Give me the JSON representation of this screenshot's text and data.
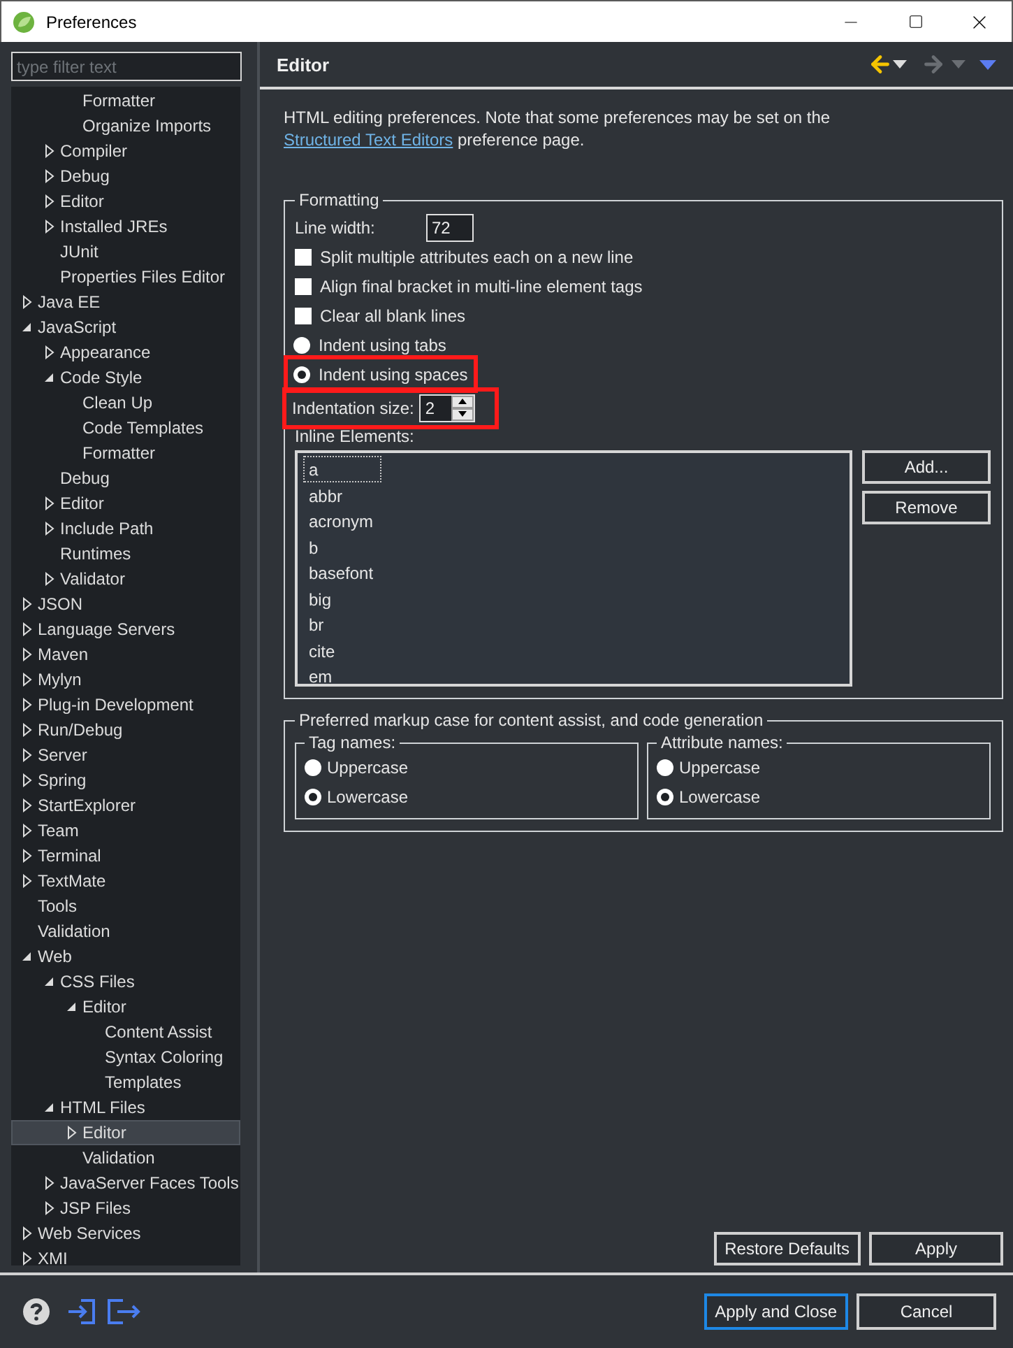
{
  "window": {
    "title": "Preferences"
  },
  "filter": {
    "placeholder": "type filter text"
  },
  "tree": [
    {
      "children": [
        {
          "children": [
            {
              "label": "Formatter",
              "selected": false
            },
            {
              "label": "Organize Imports",
              "selected": false
            }
          ]
        },
        {
          "label": "Compiler",
          "expanded": false,
          "selected": false
        },
        {
          "label": "Debug",
          "expanded": false,
          "selected": false
        },
        {
          "label": "Editor",
          "expanded": false,
          "selected": false
        },
        {
          "label": "Installed JREs",
          "expanded": false,
          "selected": false
        },
        {
          "label": "JUnit",
          "selected": false
        },
        {
          "label": "Properties Files Editor",
          "selected": false
        }
      ]
    },
    {
      "label": "Java EE",
      "expanded": false,
      "selected": false
    },
    {
      "label": "JavaScript",
      "expanded": true,
      "selected": false,
      "children": [
        {
          "label": "Appearance",
          "expanded": false,
          "selected": false
        },
        {
          "label": "Code Style",
          "expanded": true,
          "selected": false,
          "children": [
            {
              "label": "Clean Up",
              "selected": false
            },
            {
              "label": "Code Templates",
              "selected": false
            },
            {
              "label": "Formatter",
              "selected": false
            }
          ]
        },
        {
          "label": "Debug",
          "selected": false
        },
        {
          "label": "Editor",
          "expanded": false,
          "selected": false
        },
        {
          "label": "Include Path",
          "expanded": false,
          "selected": false
        },
        {
          "label": "Runtimes",
          "selected": false
        },
        {
          "label": "Validator",
          "expanded": false,
          "selected": false
        }
      ]
    },
    {
      "label": "JSON",
      "expanded": false,
      "selected": false
    },
    {
      "label": "Language Servers",
      "expanded": false,
      "selected": false
    },
    {
      "label": "Maven",
      "expanded": false,
      "selected": false
    },
    {
      "label": "Mylyn",
      "expanded": false,
      "selected": false
    },
    {
      "label": "Plug-in Development",
      "expanded": false,
      "selected": false
    },
    {
      "label": "Run/Debug",
      "expanded": false,
      "selected": false
    },
    {
      "label": "Server",
      "expanded": false,
      "selected": false
    },
    {
      "label": "Spring",
      "expanded": false,
      "selected": false
    },
    {
      "label": "StartExplorer",
      "expanded": false,
      "selected": false
    },
    {
      "label": "Team",
      "expanded": false,
      "selected": false
    },
    {
      "label": "Terminal",
      "expanded": false,
      "selected": false
    },
    {
      "label": "TextMate",
      "expanded": false,
      "selected": false
    },
    {
      "label": "Tools",
      "selected": false
    },
    {
      "label": "Validation",
      "selected": false
    },
    {
      "label": "Web",
      "expanded": true,
      "selected": false,
      "children": [
        {
          "label": "CSS Files",
          "expanded": true,
          "selected": false,
          "children": [
            {
              "label": "Editor",
              "expanded": true,
              "selected": false,
              "children": [
                {
                  "label": "Content Assist",
                  "selected": false
                },
                {
                  "label": "Syntax Coloring",
                  "selected": false
                },
                {
                  "label": "Templates",
                  "selected": false
                }
              ]
            }
          ]
        },
        {
          "label": "HTML Files",
          "expanded": true,
          "selected": false,
          "children": [
            {
              "label": "Editor",
              "expanded": false,
              "selected": true
            },
            {
              "label": "Validation",
              "selected": false
            }
          ]
        },
        {
          "label": "JavaServer Faces Tools",
          "expanded": false,
          "selected": false
        },
        {
          "label": "JSP Files",
          "expanded": false,
          "selected": false
        }
      ]
    },
    {
      "label": "Web Services",
      "expanded": false,
      "selected": false
    },
    {
      "label": "XMI",
      "expanded": false,
      "selected": false
    }
  ],
  "page": {
    "title": "Editor",
    "description": "HTML editing preferences.  Note that some preferences may be set on the ",
    "link": "Structured Text Editors",
    "description_end": " preference page."
  },
  "formatting": {
    "title": "Formatting",
    "line_width": {
      "label": "Line width:",
      "value": "72"
    },
    "options": [
      {
        "kind": "checkbox",
        "label": "Split multiple attributes each on a new line",
        "checked": false
      },
      {
        "kind": "checkbox",
        "label": "Align final bracket in multi-line element tags",
        "checked": false
      },
      {
        "kind": "checkbox",
        "label": "Clear all blank lines",
        "checked": false
      },
      {
        "kind": "radio",
        "label": "Indent using tabs",
        "selected": false,
        "highlighted": false
      },
      {
        "kind": "radio",
        "label": "Indent using spaces",
        "selected": true,
        "highlighted": true
      }
    ],
    "indentation": {
      "label": "Indentation size:",
      "value": "2",
      "highlighted": true
    },
    "inline_elements": {
      "label": "Inline Elements:",
      "items": [
        {
          "text": "a",
          "focused": true
        },
        {
          "text": "abbr",
          "focused": false
        },
        {
          "text": "acronym",
          "focused": false
        },
        {
          "text": "b",
          "focused": false
        },
        {
          "text": "basefont",
          "focused": false
        },
        {
          "text": "big",
          "focused": false
        },
        {
          "text": "br",
          "focused": false
        },
        {
          "text": "cite",
          "focused": false
        },
        {
          "text": "em",
          "focused": false
        }
      ],
      "buttons": [
        "Add...",
        "Remove"
      ]
    }
  },
  "markup_case": {
    "title": "Preferred markup case for content assist, and code generation",
    "groups": [
      {
        "title": "Tag names:",
        "options": [
          {
            "label": "Uppercase",
            "selected": false
          },
          {
            "label": "Lowercase",
            "selected": true
          }
        ]
      },
      {
        "title": "Attribute names:",
        "options": [
          {
            "label": "Uppercase",
            "selected": false
          },
          {
            "label": "Lowercase",
            "selected": true
          }
        ]
      }
    ]
  },
  "page_buttons": [
    "Restore Defaults",
    "Apply"
  ],
  "dialog_buttons": [
    {
      "label": "Apply and Close",
      "default": true
    },
    {
      "label": "Cancel",
      "default": false
    }
  ]
}
